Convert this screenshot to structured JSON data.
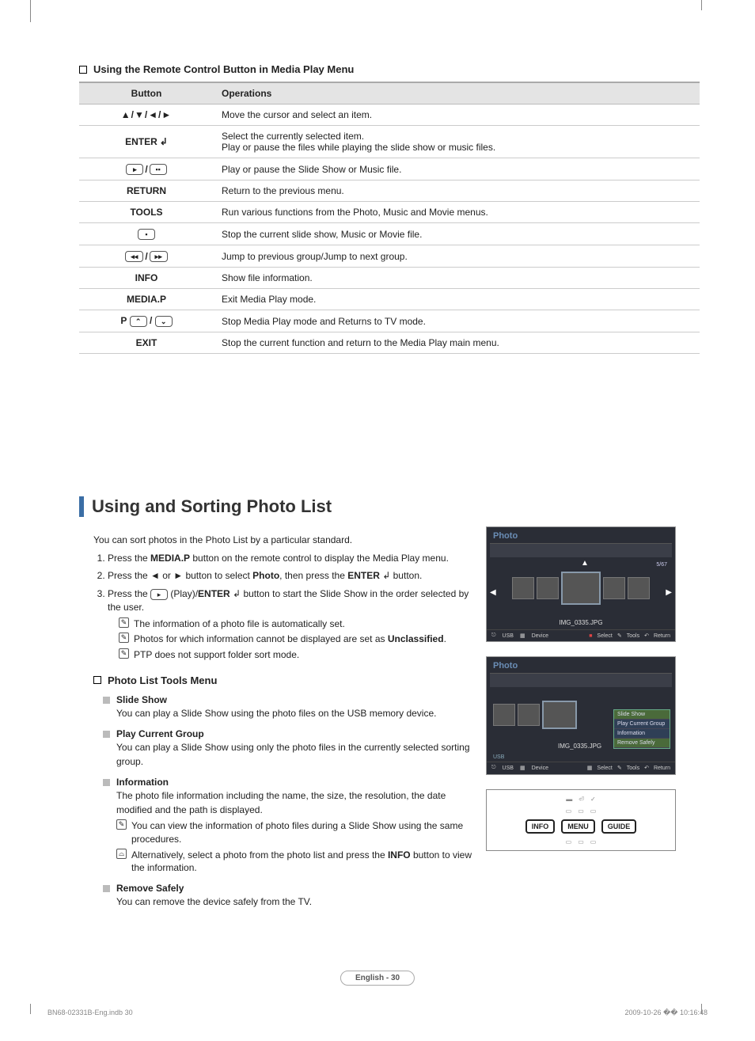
{
  "section1": {
    "title": "Using the Remote Control Button in Media Play Menu",
    "th_button": "Button",
    "th_ops": "Operations",
    "rows": [
      {
        "btn": "▲/▼/◄/►",
        "op": "Move the cursor and select an item."
      },
      {
        "btn": "ENTER",
        "op": "Select the currently selected item.\nPlay or pause the files while playing the slide show or music files."
      },
      {
        "btn": "▶ / ❚❚",
        "op": "Play or pause the Slide Show or Music file."
      },
      {
        "btn": "RETURN",
        "op": "Return to the previous menu."
      },
      {
        "btn": "TOOLS",
        "op": "Run various functions from the Photo, Music and Movie menus."
      },
      {
        "btn": "■",
        "op": "Stop the current slide show, Music or Movie file."
      },
      {
        "btn": "◄◄ / ►►",
        "op": "Jump to previous group/Jump to next group."
      },
      {
        "btn": "INFO",
        "op": "Show file information."
      },
      {
        "btn": "MEDIA.P",
        "op": "Exit Media Play mode."
      },
      {
        "btn": "P ⌃ / ⌄",
        "op": "Stop Media Play mode and Returns to TV mode."
      },
      {
        "btn": "EXIT",
        "op": "Stop the current function and return to the Media Play main menu."
      }
    ]
  },
  "h2": "Using and Sorting Photo List",
  "intro": "You can sort photos in the Photo List by a particular standard.",
  "steps": {
    "s1a": "Press the ",
    "s1b": "MEDIA.P",
    "s1c": " button on the remote control to display the Media Play menu.",
    "s2a": "Press the ◄ or ► button to select ",
    "s2b": "Photo",
    "s2c": ", then press the ",
    "s2d": "ENTER",
    "s2e": " button.",
    "s3a": "Press the ",
    "s3b": " (Play)/",
    "s3c": "ENTER",
    "s3d": " button to start the Slide Show in the order selected by the user."
  },
  "notes3": [
    "The information of a photo file is automatically set.",
    "Photos for which information cannot be displayed are set as Unclassified.",
    "PTP does not support folder sort mode."
  ],
  "tools": {
    "title": "Photo List Tools Menu",
    "items": [
      {
        "t": "Slide Show",
        "b": "You can play a Slide Show using the photo files on the USB memory device."
      },
      {
        "t": "Play Current Group",
        "b": "You can play a Slide Show using only the photo files in the currently selected sorting group."
      },
      {
        "t": "Information",
        "b": "The photo file information including the name, the size, the resolution, the date modified and the path is displayed.",
        "n1": "You can view the information of photo files during a Slide Show using the same procedures.",
        "n2a": "Alternatively, select a photo from the photo list and press the ",
        "n2b": "INFO",
        "n2c": " button to view the information."
      },
      {
        "t": "Remove Safely",
        "b": "You can remove the device safely from the TV."
      }
    ]
  },
  "mock": {
    "title": "Photo",
    "fname": "IMG_0335.JPG",
    "usb": "USB",
    "device": "Device",
    "select": "Select",
    "toolsf": "Tools",
    "ret": "Return",
    "count": "5/67",
    "ctx": [
      "Slide Show",
      "Play Current Group",
      "Information",
      "Remove Safely"
    ]
  },
  "remote": {
    "info": "INFO",
    "menu": "MENU",
    "guide": "GUIDE"
  },
  "footer_pill": "English - 30",
  "print_l": "BN68-02331B-Eng.indb   30",
  "print_r": "2009-10-26   �� 10:16:48"
}
